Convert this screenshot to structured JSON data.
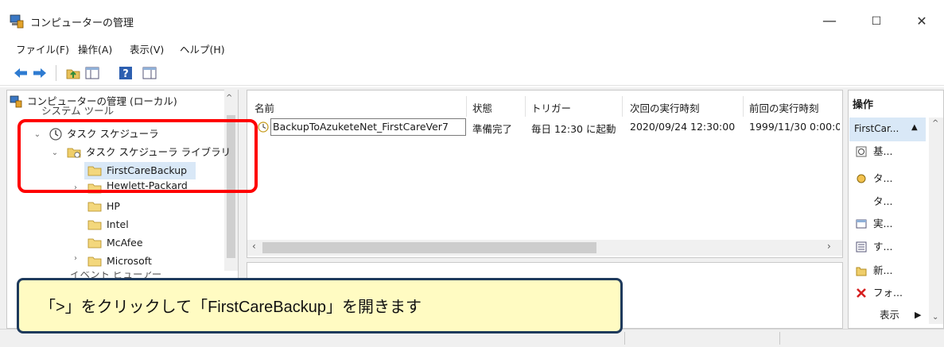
{
  "window": {
    "title": "コンピューターの管理",
    "controls": {
      "minimize": "—",
      "maximize": "☐",
      "close": "✕"
    }
  },
  "menu": [
    "ファイル(F)",
    "操作(A)",
    "表示(V)",
    "ヘルプ(H)"
  ],
  "toolbar": {
    "icons": [
      "back-arrow-icon",
      "forward-arrow-icon",
      "folder-up-icon",
      "show-hide-tree-icon",
      "help-icon",
      "show-hide-action-icon"
    ]
  },
  "tree": {
    "root": "コンピューターの管理 (ローカル)",
    "system_tools": "システム ツール",
    "task_scheduler": "タスク スケジューラ",
    "library": "タスク スケジューラ ライブラリ",
    "folders": [
      "FirstCareBackup",
      "Hewlett-Packard",
      "HP",
      "Intel",
      "McAfee",
      "Microsoft"
    ],
    "event_viewer": "イベント ビューアー"
  },
  "list": {
    "columns": [
      "名前",
      "状態",
      "トリガー",
      "次回の実行時刻",
      "前回の実行時刻"
    ],
    "rows": [
      {
        "name": "BackupToAzuketeNet_FirstCareVer7",
        "status": "準備完了",
        "trigger": "毎日 12:30 に起動",
        "next_run": "2020/09/24 12:30:00",
        "last_run": "1999/11/30 0:00:0"
      }
    ]
  },
  "actions": {
    "header": "操作",
    "selected_item": "FirstCar...",
    "items": [
      {
        "icon": "basic-task-icon",
        "label": "基..."
      },
      {
        "icon": "task-icon",
        "label": "タ..."
      },
      {
        "icon": "",
        "label": "タ..."
      },
      {
        "icon": "run-icon",
        "label": "実..."
      },
      {
        "icon": "all-icon",
        "label": "す..."
      },
      {
        "icon": "new-folder-icon",
        "label": "新..."
      },
      {
        "icon": "delete-icon",
        "label": "フォ..."
      }
    ],
    "view_label": "表示"
  },
  "colors": {
    "highlight_border": "#ff0000",
    "callout_bg": "#fffbc2",
    "callout_border": "#1e3a5c",
    "selection_band": "#d9e8f7"
  },
  "callout": {
    "text": "「>」をクリックして「FirstCareBackup」を開きます"
  }
}
